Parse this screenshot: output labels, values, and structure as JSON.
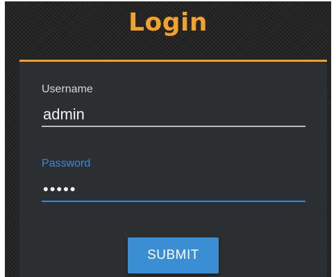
{
  "header": {
    "title": "Login"
  },
  "form": {
    "username": {
      "label": "Username",
      "value": "admin"
    },
    "password": {
      "label": "Password",
      "value": "•••••"
    },
    "submit_label": "SUBMIT"
  },
  "colors": {
    "accent": "#f0a22c",
    "focus_blue": "#3b8ad9",
    "button": "#3a8fd4",
    "panel": "#2c2f32",
    "background": "#262626"
  }
}
